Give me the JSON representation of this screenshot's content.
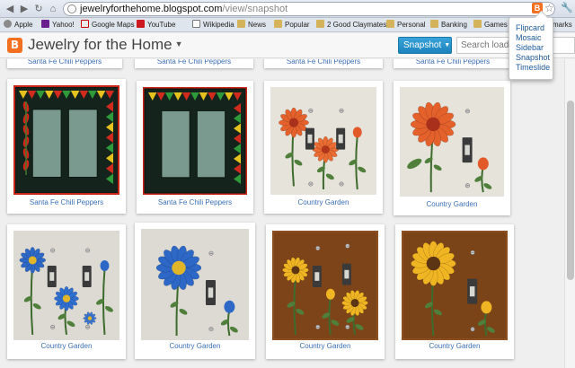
{
  "browser": {
    "url_host": "jewelryforthehome.blogspot.com",
    "url_path": "/view/snapshot",
    "extension_letter": "B",
    "bookmarks": [
      {
        "label": "Apple",
        "icon": "apple"
      },
      {
        "label": "Yahoo!",
        "icon": "yahoo"
      },
      {
        "label": "Google Maps",
        "icon": "gmaps"
      },
      {
        "label": "YouTube",
        "icon": "yt"
      },
      {
        "label": "Wikipedia",
        "icon": "wiki"
      },
      {
        "label": "News",
        "icon": "folder"
      },
      {
        "label": "Popular",
        "icon": "folder"
      },
      {
        "label": "2 Good Claymates",
        "icon": "folder"
      },
      {
        "label": "Personal",
        "icon": "folder"
      },
      {
        "label": "Banking",
        "icon": "folder"
      },
      {
        "label": "Games",
        "icon": "folder"
      },
      {
        "label": "marks",
        "icon": "other"
      }
    ]
  },
  "blog": {
    "logo_letter": "B",
    "title": "Jewelry for the Home",
    "view_button": "Snapshot",
    "search_placeholder": "Search loaded"
  },
  "view_menu": [
    "Flipcard",
    "Mosaic",
    "Sidebar",
    "Snapshot",
    "Timeslide"
  ],
  "posts": [
    {
      "caption": "Santa Fe Chili Peppers",
      "style": "chili-a"
    },
    {
      "caption": "Santa Fe Chili Peppers",
      "style": "chili-b"
    },
    {
      "caption": "Santa Fe Chili Peppers",
      "style": "chili-a"
    },
    {
      "caption": "Santa Fe Chili Peppers",
      "style": "chili-b"
    },
    {
      "caption": "Santa Fe Chili Peppers",
      "style": "chili-a"
    },
    {
      "caption": "Santa Fe Chili Peppers",
      "style": "chili-b"
    },
    {
      "caption": "Country Garden",
      "style": "orange"
    },
    {
      "caption": "Country Garden",
      "style": "orange-big"
    },
    {
      "caption": "Country Garden",
      "style": "blue"
    },
    {
      "caption": "Country Garden",
      "style": "blue-big"
    },
    {
      "caption": "Country Garden",
      "style": "sun"
    },
    {
      "caption": "Country Garden",
      "style": "sun-big"
    }
  ],
  "colors": {
    "accent_blue": "#1d84bd",
    "link_blue": "#3b6fb6",
    "blogger_orange": "#f37021"
  }
}
